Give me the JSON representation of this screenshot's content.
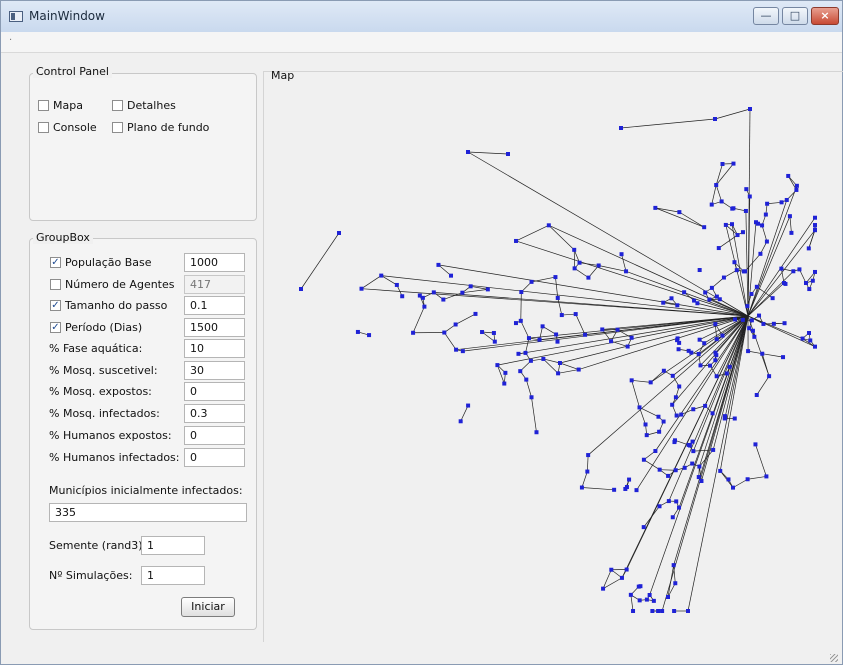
{
  "window": {
    "title": "MainWindow",
    "buttons": {
      "minimize": "—",
      "maximize": "□",
      "close": "×"
    }
  },
  "control_panel": {
    "title": "Control Panel",
    "options": [
      {
        "label": "Mapa",
        "checked": false
      },
      {
        "label": "Detalhes",
        "checked": false
      },
      {
        "label": "Console",
        "checked": false
      },
      {
        "label": "Plano de fundo",
        "checked": false
      }
    ]
  },
  "group_box": {
    "title": "GroupBox",
    "rows": [
      {
        "label": "População Base",
        "checkbox": true,
        "checked": true,
        "value": "1000",
        "disabled": false
      },
      {
        "label": "Número de Agentes",
        "checkbox": true,
        "checked": false,
        "value": "417",
        "disabled": true
      },
      {
        "label": "Tamanho do passo",
        "checkbox": true,
        "checked": true,
        "value": "0.1",
        "disabled": false
      },
      {
        "label": "Período (Dias)",
        "checkbox": true,
        "checked": true,
        "value": "1500",
        "disabled": false
      },
      {
        "label": "% Fase aquática:",
        "checkbox": false,
        "value": "10"
      },
      {
        "label": "% Mosq. suscetivel:",
        "checkbox": false,
        "value": "30"
      },
      {
        "label": "% Mosq. expostos:",
        "checkbox": false,
        "value": "0"
      },
      {
        "label": "% Mosq. infectados:",
        "checkbox": false,
        "value": "0.3"
      },
      {
        "label": "% Humanos expostos:",
        "checkbox": false,
        "value": "0"
      },
      {
        "label": "% Humanos infectados:",
        "checkbox": false,
        "value": "0"
      }
    ],
    "infected_municipalities": {
      "label": "Municípios inicialmente infectados:",
      "value": "335"
    },
    "seed": {
      "label": "Semente (rand3):",
      "value": "1"
    },
    "simulations": {
      "label": "Nº Simulações:",
      "value": "1"
    },
    "start_button": "Iniciar"
  },
  "map": {
    "title": "Map",
    "node_color": "#1f22d6",
    "edge_color": "#222222"
  }
}
